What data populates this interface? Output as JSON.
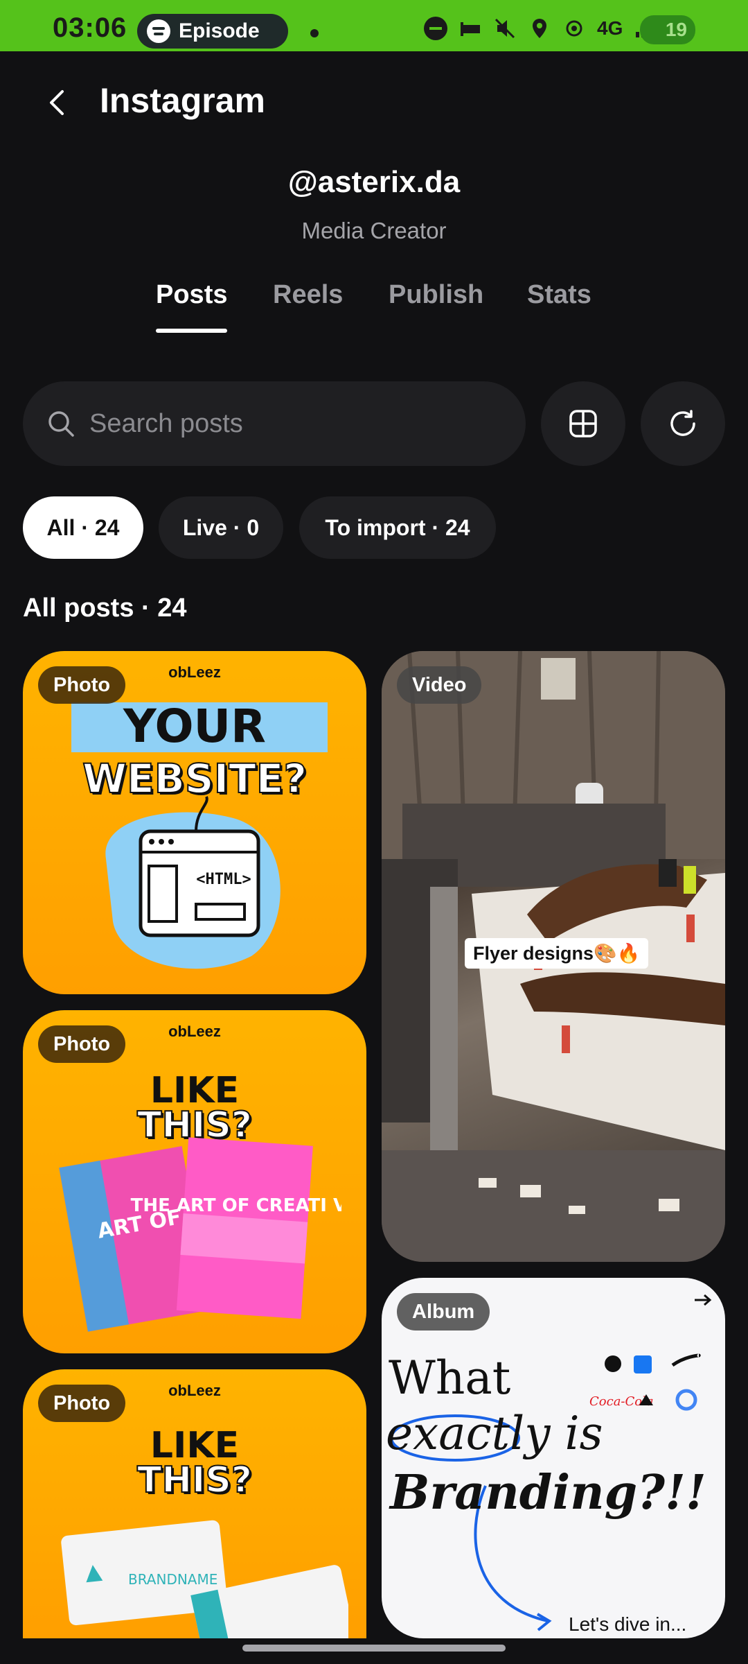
{
  "status_bar": {
    "time": "03:06",
    "media_pill": "Episode",
    "battery": "19",
    "network": "4G"
  },
  "header": {
    "title": "Instagram",
    "back_icon": "chevron-left-icon"
  },
  "profile": {
    "username": "@asterix.da",
    "role": "Media Creator"
  },
  "tabs": [
    {
      "label": "Posts",
      "active": true
    },
    {
      "label": "Reels",
      "active": false
    },
    {
      "label": "Publish",
      "active": false
    },
    {
      "label": "Stats",
      "active": false
    }
  ],
  "search": {
    "placeholder": "Search posts",
    "value": ""
  },
  "filters": [
    {
      "label": "All · 24",
      "active": true
    },
    {
      "label": "Live · 0",
      "active": false
    },
    {
      "label": "To import · 24",
      "active": false
    }
  ],
  "section_title": "All posts · 24",
  "posts": [
    {
      "type": "Photo",
      "brand": "obLeez",
      "headline_1": "YOUR",
      "headline_2": "WEBSITE?",
      "art_text": "<HTML>"
    },
    {
      "type": "Video",
      "caption": "Flyer designs🎨🔥"
    },
    {
      "type": "Photo",
      "brand": "obLeez",
      "headline_1": "LIKE",
      "headline_2": "THIS?",
      "art_text": "THE ART OF CREATI VITY"
    },
    {
      "type": "Album",
      "line_1": "What",
      "line_2": "exactly is",
      "line_3": "Branding?!!",
      "footer": "Let's dive in..."
    },
    {
      "type": "Photo",
      "brand": "obLeez",
      "headline_1": "LIKE",
      "headline_2": "THIS?",
      "art_text": "BRANDNAME"
    }
  ],
  "colors": {
    "background": "#111113",
    "status_bar": "#55c21b",
    "poster_orange": "#ffb300"
  }
}
